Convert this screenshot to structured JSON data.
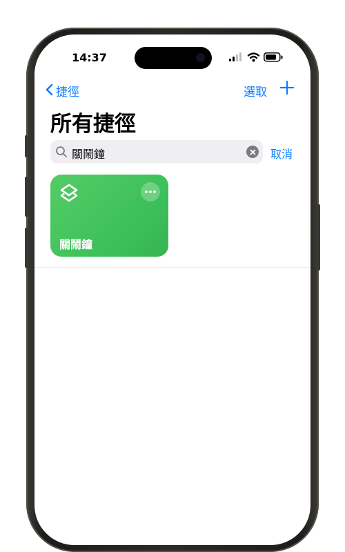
{
  "status_bar": {
    "time": "14:37",
    "signal_icon": "cellular-signal-icon",
    "wifi_icon": "wifi-icon",
    "battery_icon": "battery-icon"
  },
  "nav": {
    "back_label": "捷徑",
    "select_label": "選取",
    "add_icon": "plus-icon"
  },
  "page": {
    "title": "所有捷徑"
  },
  "search": {
    "value": "關鬧鐘",
    "cancel_label": "取消"
  },
  "shortcuts": [
    {
      "name": "關鬧鐘",
      "color": "#45c55c",
      "icon": "shortcuts-stack-icon"
    }
  ],
  "colors": {
    "accent": "#0a7aff",
    "card_green": "#45c55c",
    "search_bg": "#efeff3"
  }
}
